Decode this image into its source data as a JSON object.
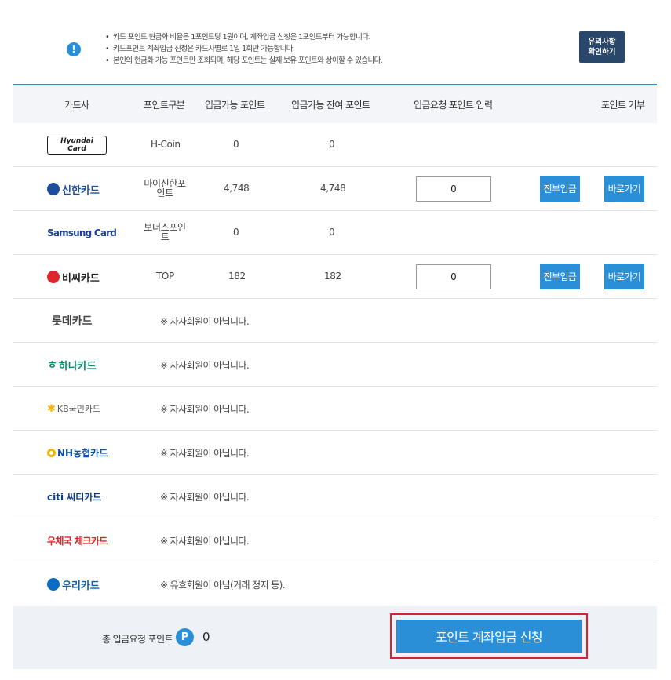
{
  "notice": {
    "icon": "info-icon",
    "lines": [
      "카드 포인트 현금화 비율은 1포인트당 1원이며, 계좌입금 신청은 1포인트부터 가능합니다.",
      "카드포인트 계좌입금 신청은 카드사별로 1일 1회만 가능합니다.",
      "본인의 현금화 가능 포인트만 조회되며, 해당 포인트는 실제 보유 포인트와 상이할 수 있습니다."
    ],
    "button_line1": "유의사항",
    "button_line2": "확인하기"
  },
  "headers": {
    "card": "카드사",
    "type": "포인트구분",
    "available": "입금가능 포인트",
    "remaining": "입금가능 잔여 포인트",
    "request": "입금요청 포인트 입력",
    "donate": "포인트 기부"
  },
  "rows": [
    {
      "logo": "Hyundai Card",
      "type": "H-Coin",
      "available": "0",
      "remaining": "0"
    },
    {
      "logo": "신한카드",
      "type": "마이신한포인트",
      "available": "4,748",
      "remaining": "4,748",
      "input": "0",
      "btn_all": "전부입금",
      "btn_go": "바로가기"
    },
    {
      "logo": "Samsung Card",
      "type": "보너스포인트",
      "available": "0",
      "remaining": "0"
    },
    {
      "logo": "비씨카드",
      "type": "TOP",
      "available": "182",
      "remaining": "182",
      "input": "0",
      "btn_all": "전부입금",
      "btn_go": "바로가기"
    },
    {
      "logo": "롯데카드",
      "message": "※ 자사회원이 아닙니다."
    },
    {
      "logo": "하나카드",
      "message": "※ 자사회원이 아닙니다."
    },
    {
      "logo": "KB국민카드",
      "message": "※ 자사회원이 아닙니다."
    },
    {
      "logo": "NH농협카드",
      "message": "※ 자사회원이 아닙니다."
    },
    {
      "logo": "citi 씨티카드",
      "message": "※ 자사회원이 아닙니다."
    },
    {
      "logo": "우체국 체크카드",
      "message": "※ 자사회원이 아닙니다."
    },
    {
      "logo": "우리카드",
      "message": "※ 유효회원이 아님(거래 정지 등)."
    }
  ],
  "footer": {
    "total_label": "총 입금요청 포인트",
    "badge": "P",
    "total_value": "0",
    "submit_label": "포인트 계좌입금 신청"
  },
  "colors": {
    "accent": "#2a8fd6",
    "notice_button": "#28476b",
    "highlight_frame": "#d9222a",
    "header_bg": "#f3f5f8",
    "footer_bg": "#eef2f7"
  }
}
